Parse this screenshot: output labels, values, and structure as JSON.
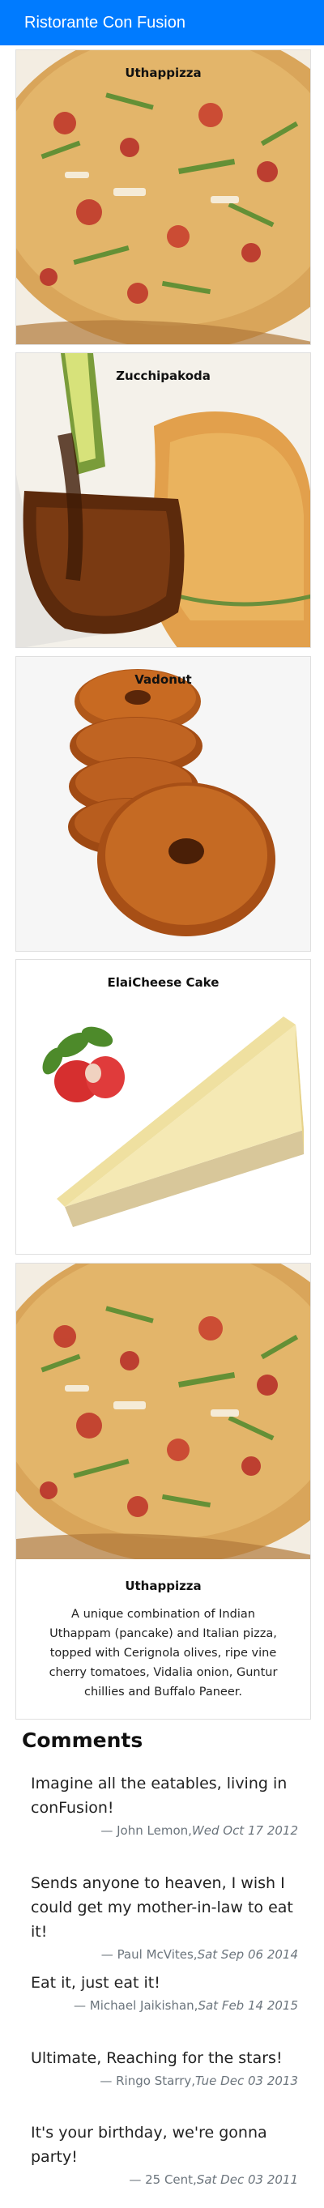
{
  "navbar": {
    "brand": "Ristorante Con Fusion"
  },
  "dishes": [
    {
      "name": "Uthappizza"
    },
    {
      "name": "Zucchipakoda"
    },
    {
      "name": "Vadonut"
    },
    {
      "name": "ElaiCheese Cake"
    }
  ],
  "selected_dish": {
    "name": "Uthappizza",
    "description": "A unique combination of Indian Uthappam (pancake) and Italian pizza, topped with Cerignola olives, ripe vine cherry tomatoes, Vidalia onion, Guntur chillies and Buffalo Paneer."
  },
  "comments_heading": "Comments",
  "comments": [
    {
      "text": "Imagine all the eatables, living in conFusion!",
      "author": "— John Lemon,",
      "date": "Wed Oct 17 2012"
    },
    {
      "text": "Sends anyone to heaven, I wish I could get my mother-in-law to eat it!",
      "author": "— Paul McVites,",
      "date": "Sat Sep 06 2014"
    },
    {
      "text": "Eat it, just eat it!",
      "author": "— Michael Jaikishan,",
      "date": "Sat Feb 14 2015"
    },
    {
      "text": "Ultimate, Reaching for the stars!",
      "author": "— Ringo Starry,",
      "date": "Tue Dec 03 2013"
    },
    {
      "text": "It's your birthday, we're gonna party!",
      "author": "— 25 Cent,",
      "date": "Sat Dec 03 2011"
    }
  ]
}
